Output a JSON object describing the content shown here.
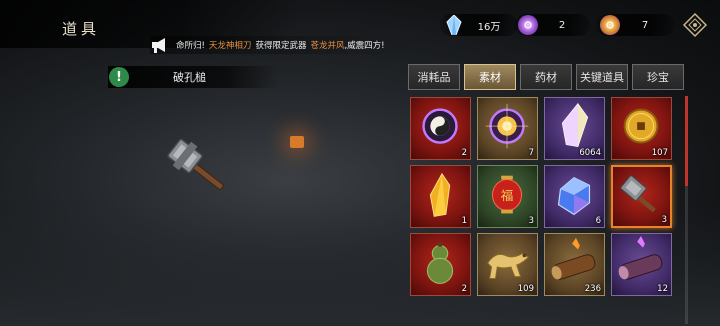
{
  "header": {
    "title": "道具"
  },
  "currencies": [
    {
      "icon": "crystal-icon",
      "value": "16万"
    },
    {
      "icon": "purple-orb-icon",
      "value": "2"
    },
    {
      "icon": "orange-orb-icon",
      "value": "7"
    }
  ],
  "notice": {
    "prefix": "命所归!",
    "weapon": "天龙神相刀",
    "middle": "获得限定武器",
    "skin": "苍龙并风",
    "suffix": ",威震四方!"
  },
  "selected_item": {
    "name": "破孔槌"
  },
  "tabs": [
    {
      "label": "消耗品",
      "active": false
    },
    {
      "label": "素材",
      "active": true
    },
    {
      "label": "药材",
      "active": false
    },
    {
      "label": "关键道具",
      "active": false
    },
    {
      "label": "珍宝",
      "active": false
    }
  ],
  "items": [
    {
      "name": "purple-taiji-talisman",
      "rarity": "red",
      "count": "2"
    },
    {
      "name": "golden-orb-talisman",
      "rarity": "gold",
      "count": "7"
    },
    {
      "name": "rainbow-crystal",
      "rarity": "purple",
      "count": "6064"
    },
    {
      "name": "gold-coin",
      "rarity": "red",
      "count": "107"
    },
    {
      "name": "amber-crystal",
      "rarity": "red",
      "count": "1"
    },
    {
      "name": "red-lantern",
      "rarity": "green",
      "count": "3"
    },
    {
      "name": "blue-gem",
      "rarity": "purple",
      "count": "6"
    },
    {
      "name": "war-hammer",
      "rarity": "red",
      "count": "3"
    },
    {
      "name": "gourd",
      "rarity": "red",
      "count": "2"
    },
    {
      "name": "golden-beast",
      "rarity": "gold",
      "count": "109"
    },
    {
      "name": "wooden-log",
      "rarity": "gold",
      "count": "236"
    },
    {
      "name": "purple-log",
      "rarity": "purple",
      "count": "12"
    }
  ],
  "colors": {
    "accent": "#e8832a",
    "active_tab": "#a08a60",
    "alert": "#2e8a49"
  }
}
